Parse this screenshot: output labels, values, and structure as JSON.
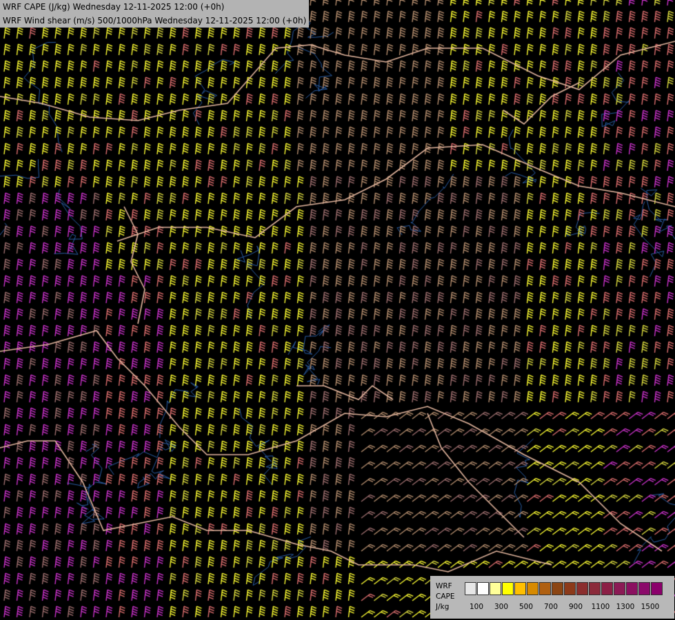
{
  "title": {
    "line1": "WRF CAPE (J/kg) Wednesday 12-11-2025 12:00 (+0h)",
    "line2": "WRF Wind shear (m/s) 500/1000hPa Wednesday 12-11-2025 12:00 (+0h)"
  },
  "legend": {
    "line1": "WRF",
    "line2": "CAPE",
    "line3": "J/kg",
    "colors": [
      "#e6e6e6",
      "#ffffff",
      "#ffff99",
      "#ffff00",
      "#ffbf00",
      "#d78a00",
      "#b06010",
      "#8b4513",
      "#8c3a1a",
      "#8b2e2e",
      "#8b2a3a",
      "#8b1f45",
      "#8b1a55",
      "#8b1060",
      "#8b0a6a",
      "#8b006b"
    ],
    "ticks": [
      "100",
      "300",
      "500",
      "700",
      "900",
      "1100",
      "1300",
      "1500"
    ]
  },
  "map": {
    "background": "#000000",
    "barb_colors": [
      "#ffff33",
      "#e0e040",
      "#c8a060",
      "#e07070",
      "#cc33cc",
      "#a07070",
      "#b89070"
    ],
    "border_color": "#e6b8a0",
    "river_color": "#2a5fa8"
  }
}
